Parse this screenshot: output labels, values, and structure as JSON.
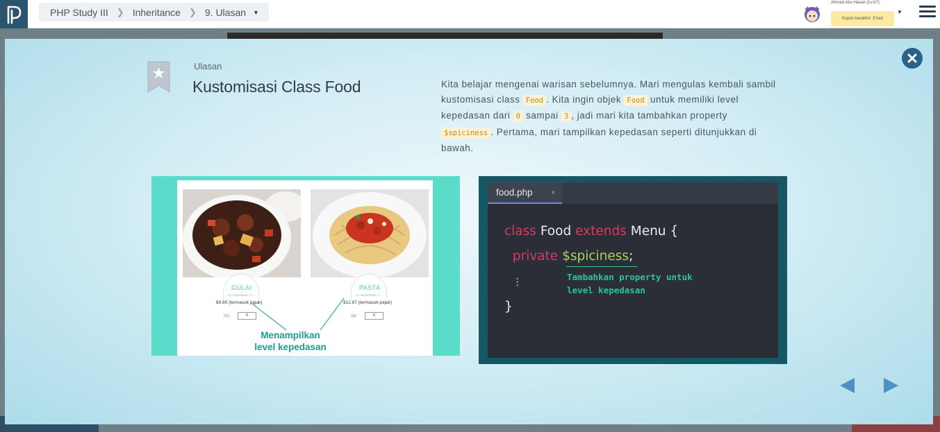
{
  "breadcrumb": {
    "course": "PHP Study III",
    "chapter": "Inheritance",
    "lesson": "9. Ulasan"
  },
  "user": {
    "name": "Ahmad Abu Hasan (Lv.67)",
    "coupon": "Kupon berakhir: 3 hari"
  },
  "modal": {
    "label": "Ulasan",
    "title": "Kustomisasi Class Food",
    "description": {
      "p1": "Kita belajar mengenai warisan sebelumnya. Mari mengulas kembali sambil kustomisasi class ",
      "c1": "Food",
      "p2": ". Kita ingin objek ",
      "c2": "Food",
      "p3": " untuk memiliki level kepedasan dari ",
      "c3": "0",
      "p4": " sampai ",
      "c4": "3",
      "p5": ", jadi mari kita tambahkan property ",
      "c5": "$spiciness",
      "p6": ". Pertama, mari tampilkan kepedasan seperti ditunjukkan di bawah."
    }
  },
  "food_image": {
    "dish1": {
      "name": "GULAI",
      "spice": "Lv. Kepedasan: 3",
      "price": "$9.65 (termasuk pajak)",
      "qty_label": "Qty:",
      "qty": "0"
    },
    "dish2": {
      "name": "PASTA",
      "spice": "Lv. Kepedasan: 1",
      "price": "$12.87 (termasuk pajak)",
      "qty_label": "Qty:",
      "qty": "0"
    },
    "annotation_line1": "Menampilkan",
    "annotation_line2": "level kepedasan"
  },
  "code_image": {
    "tab": "food.php",
    "tab_close": "×",
    "line1": {
      "kw1": "class",
      "name": "Food",
      "kw2": "extends",
      "parent": "Menu {"
    },
    "line2": {
      "kw": "private",
      "var": "$spiciness",
      "end": ";"
    },
    "line3": "⋮",
    "line4": "}",
    "annotation_line1": "Tambahkan property untuk",
    "annotation_line2": "level kepedasan"
  },
  "colors": {
    "accent": "#2b6288",
    "panel_teal": "#5bdccb",
    "code_bg": "#2b2e36",
    "keyword": "#d83a63",
    "variable": "#a4d35e",
    "annotation": "#2ec48e"
  }
}
